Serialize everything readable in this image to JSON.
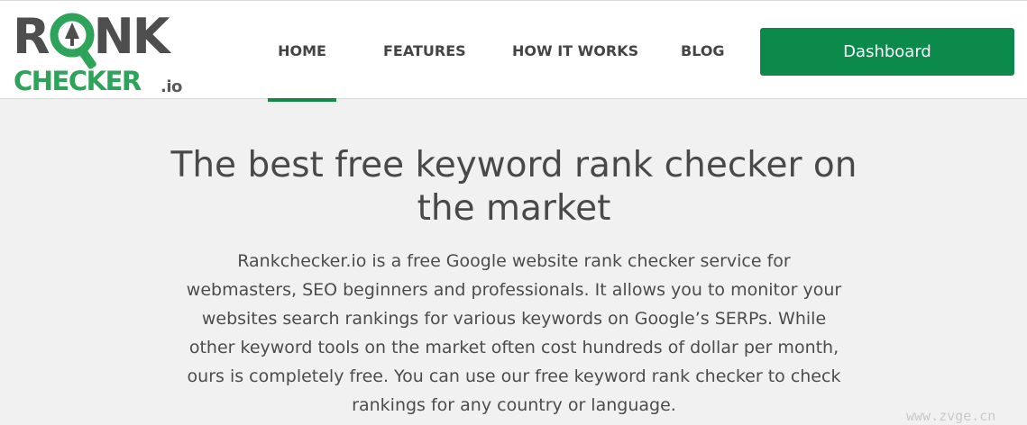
{
  "brand": {
    "logo_rank": "RANK",
    "logo_checker": "CHECKER",
    "logo_tld": ".io",
    "colors": {
      "dark": "#4e4e4e",
      "green": "#2ea35a"
    }
  },
  "nav": {
    "items": [
      {
        "label": "HOME",
        "active": true
      },
      {
        "label": "FEATURES",
        "active": false
      },
      {
        "label": "HOW IT WORKS",
        "active": false
      },
      {
        "label": "BLOG",
        "active": false
      }
    ],
    "active_color": "#17864b"
  },
  "cta": {
    "label": "Dashboard",
    "color": "#0b8a4c"
  },
  "hero": {
    "title": "The best free keyword rank checker on the market",
    "body": "Rankchecker.io is a free Google website rank checker service for webmasters, SEO beginners and professionals. It allows you to monitor your websites search rankings for various keywords on Google’s SERPs. While other keyword tools on the market often cost hundreds of dollar per month, ours is completely free. You can use our free keyword rank checker to check rankings for any country or language."
  },
  "watermark": "www.zvge.cn"
}
